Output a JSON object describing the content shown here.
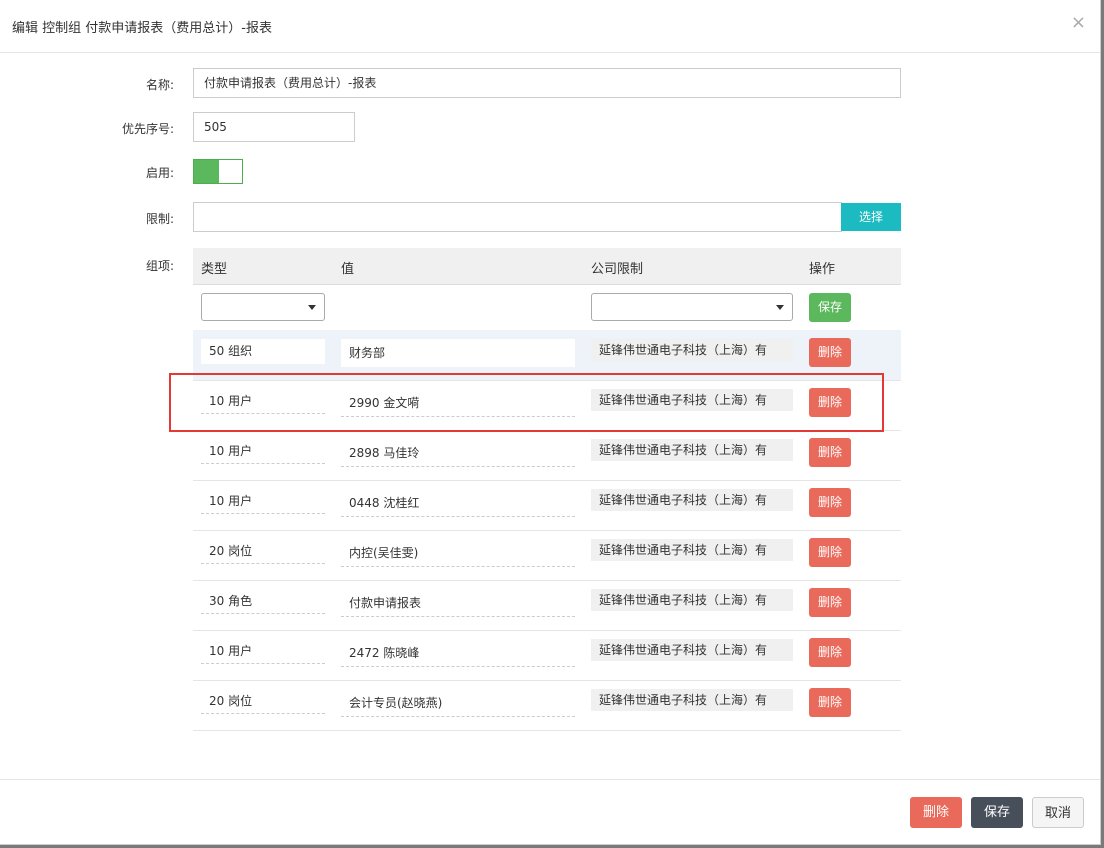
{
  "header": {
    "title": "编辑 控制组 付款申请报表（费用总计）-报表",
    "close_label": "×"
  },
  "form": {
    "name_label": "名称:",
    "name_value": "付款申请报表（费用总计）-报表",
    "priority_label": "优先序号:",
    "priority_value": "505",
    "enabled_label": "启用:",
    "enabled": true,
    "restrict_label": "限制:",
    "restrict_value": "",
    "select_button": "选择",
    "items_label": "组项:"
  },
  "grid": {
    "headers": {
      "type": "类型",
      "value": "值",
      "company": "公司限制",
      "action": "操作"
    },
    "new_row": {
      "type_value": "",
      "company_value": "",
      "save_button": "保存"
    },
    "delete_label": "删除",
    "rows": [
      {
        "type": "50 组织",
        "value": "财务部",
        "company": "延锋伟世通电子科技（上海）有"
      },
      {
        "type": "10 用户",
        "value": "2990 金文嗬",
        "company": "延锋伟世通电子科技（上海）有"
      },
      {
        "type": "10 用户",
        "value": "2898 马佳玲",
        "company": "延锋伟世通电子科技（上海）有"
      },
      {
        "type": "10 用户",
        "value": "0448 沈桂红",
        "company": "延锋伟世通电子科技（上海）有"
      },
      {
        "type": "20 岗位",
        "value": "内控(吴佳雯)",
        "company": "延锋伟世通电子科技（上海）有"
      },
      {
        "type": "30 角色",
        "value": "付款申请报表",
        "company": "延锋伟世通电子科技（上海）有"
      },
      {
        "type": "10 用户",
        "value": "2472 陈晓峰",
        "company": "延锋伟世通电子科技（上海）有"
      },
      {
        "type": "20 岗位",
        "value": "会计专员(赵晓燕)",
        "company": "延锋伟世通电子科技（上海）有"
      }
    ]
  },
  "footer": {
    "delete_button": "删除",
    "save_button": "保存",
    "cancel_button": "取消"
  },
  "colors": {
    "select_accent": "#1bbbc1",
    "save_green": "#5cb85c",
    "delete_red": "#e9695a",
    "highlight_red": "#e53935"
  }
}
